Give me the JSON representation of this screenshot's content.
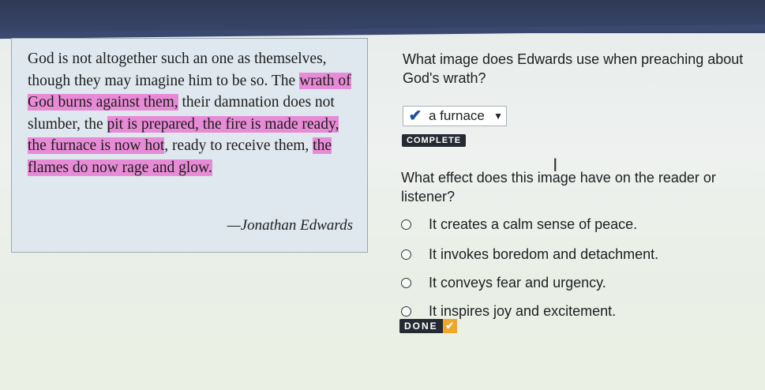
{
  "passage": {
    "segments": [
      {
        "text": "God is not altogether such an one as themselves, though they may imagine him to be so. The ",
        "highlight": false
      },
      {
        "text": "wrath of God burns against them,",
        "highlight": true
      },
      {
        "text": " their damnation does not slumber, the ",
        "highlight": false
      },
      {
        "text": "pit is prepared, the fire is made ready, the furnace is now hot",
        "highlight": true
      },
      {
        "text": ", ready to receive them, ",
        "highlight": false
      },
      {
        "text": "the flames do now rage and glow.",
        "highlight": true
      }
    ],
    "attribution": "—Jonathan Edwards",
    "highlight_color": "#e88bd6"
  },
  "question1": {
    "prompt": "What image does Edwards use when preaching about God's wrath?",
    "selected_answer": "a furnace",
    "status_badge": "COMPLETE"
  },
  "question2": {
    "prompt": "What effect does this image have on the reader or listener?",
    "options": [
      "It creates a calm sense of peace.",
      "It invokes boredom and detachment.",
      "It conveys fear and urgency.",
      "It inspires joy and excitement."
    ]
  },
  "done_button": {
    "label": "DONE"
  },
  "icons": {
    "selected_check": "check-icon",
    "dropdown": "chevron-down-icon",
    "text_cursor": "text-cursor-icon"
  },
  "colors": {
    "accent": "#1f4fa3",
    "badge": "#262a33",
    "done_check": "#f0a62a"
  }
}
